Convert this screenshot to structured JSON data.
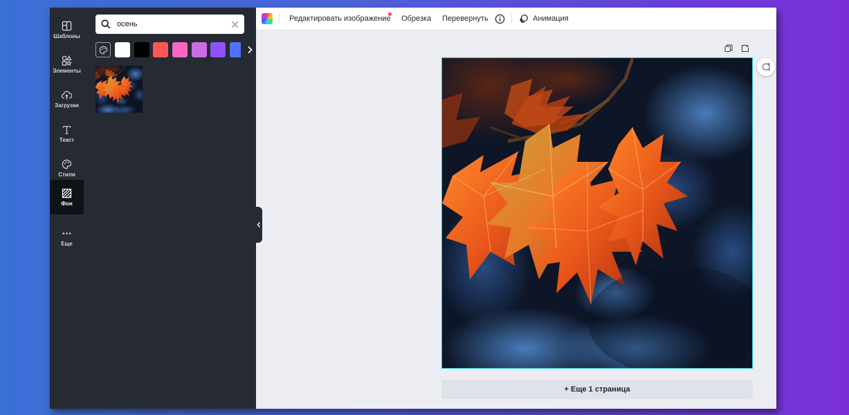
{
  "rail": {
    "items": [
      {
        "label": "Шаблоны",
        "icon": "templates-icon"
      },
      {
        "label": "Элементы",
        "icon": "shapes-icon"
      },
      {
        "label": "Загрузки",
        "icon": "upload-cloud-icon"
      },
      {
        "label": "Текст",
        "icon": "text-icon"
      },
      {
        "label": "Стили",
        "icon": "palette-icon"
      },
      {
        "label": "Фон",
        "icon": "hatch-pattern-icon",
        "active": true
      },
      {
        "label": "Еще",
        "icon": "more-dots-icon"
      }
    ]
  },
  "panel": {
    "search": {
      "value": "осень"
    },
    "swatches": [
      "#ffffff",
      "#000000",
      "#ff5757",
      "#ff66c4",
      "#cb6ce6",
      "#8c52ff",
      "#5271ff"
    ]
  },
  "toolbar": {
    "edit_image": "Редактировать изображение",
    "crop": "Обрезка",
    "flip": "Перевернуть",
    "animate": "Анимация"
  },
  "canvas": {
    "add_page": "+ Еще 1 страница",
    "selection_color": "#1ec8d6"
  }
}
